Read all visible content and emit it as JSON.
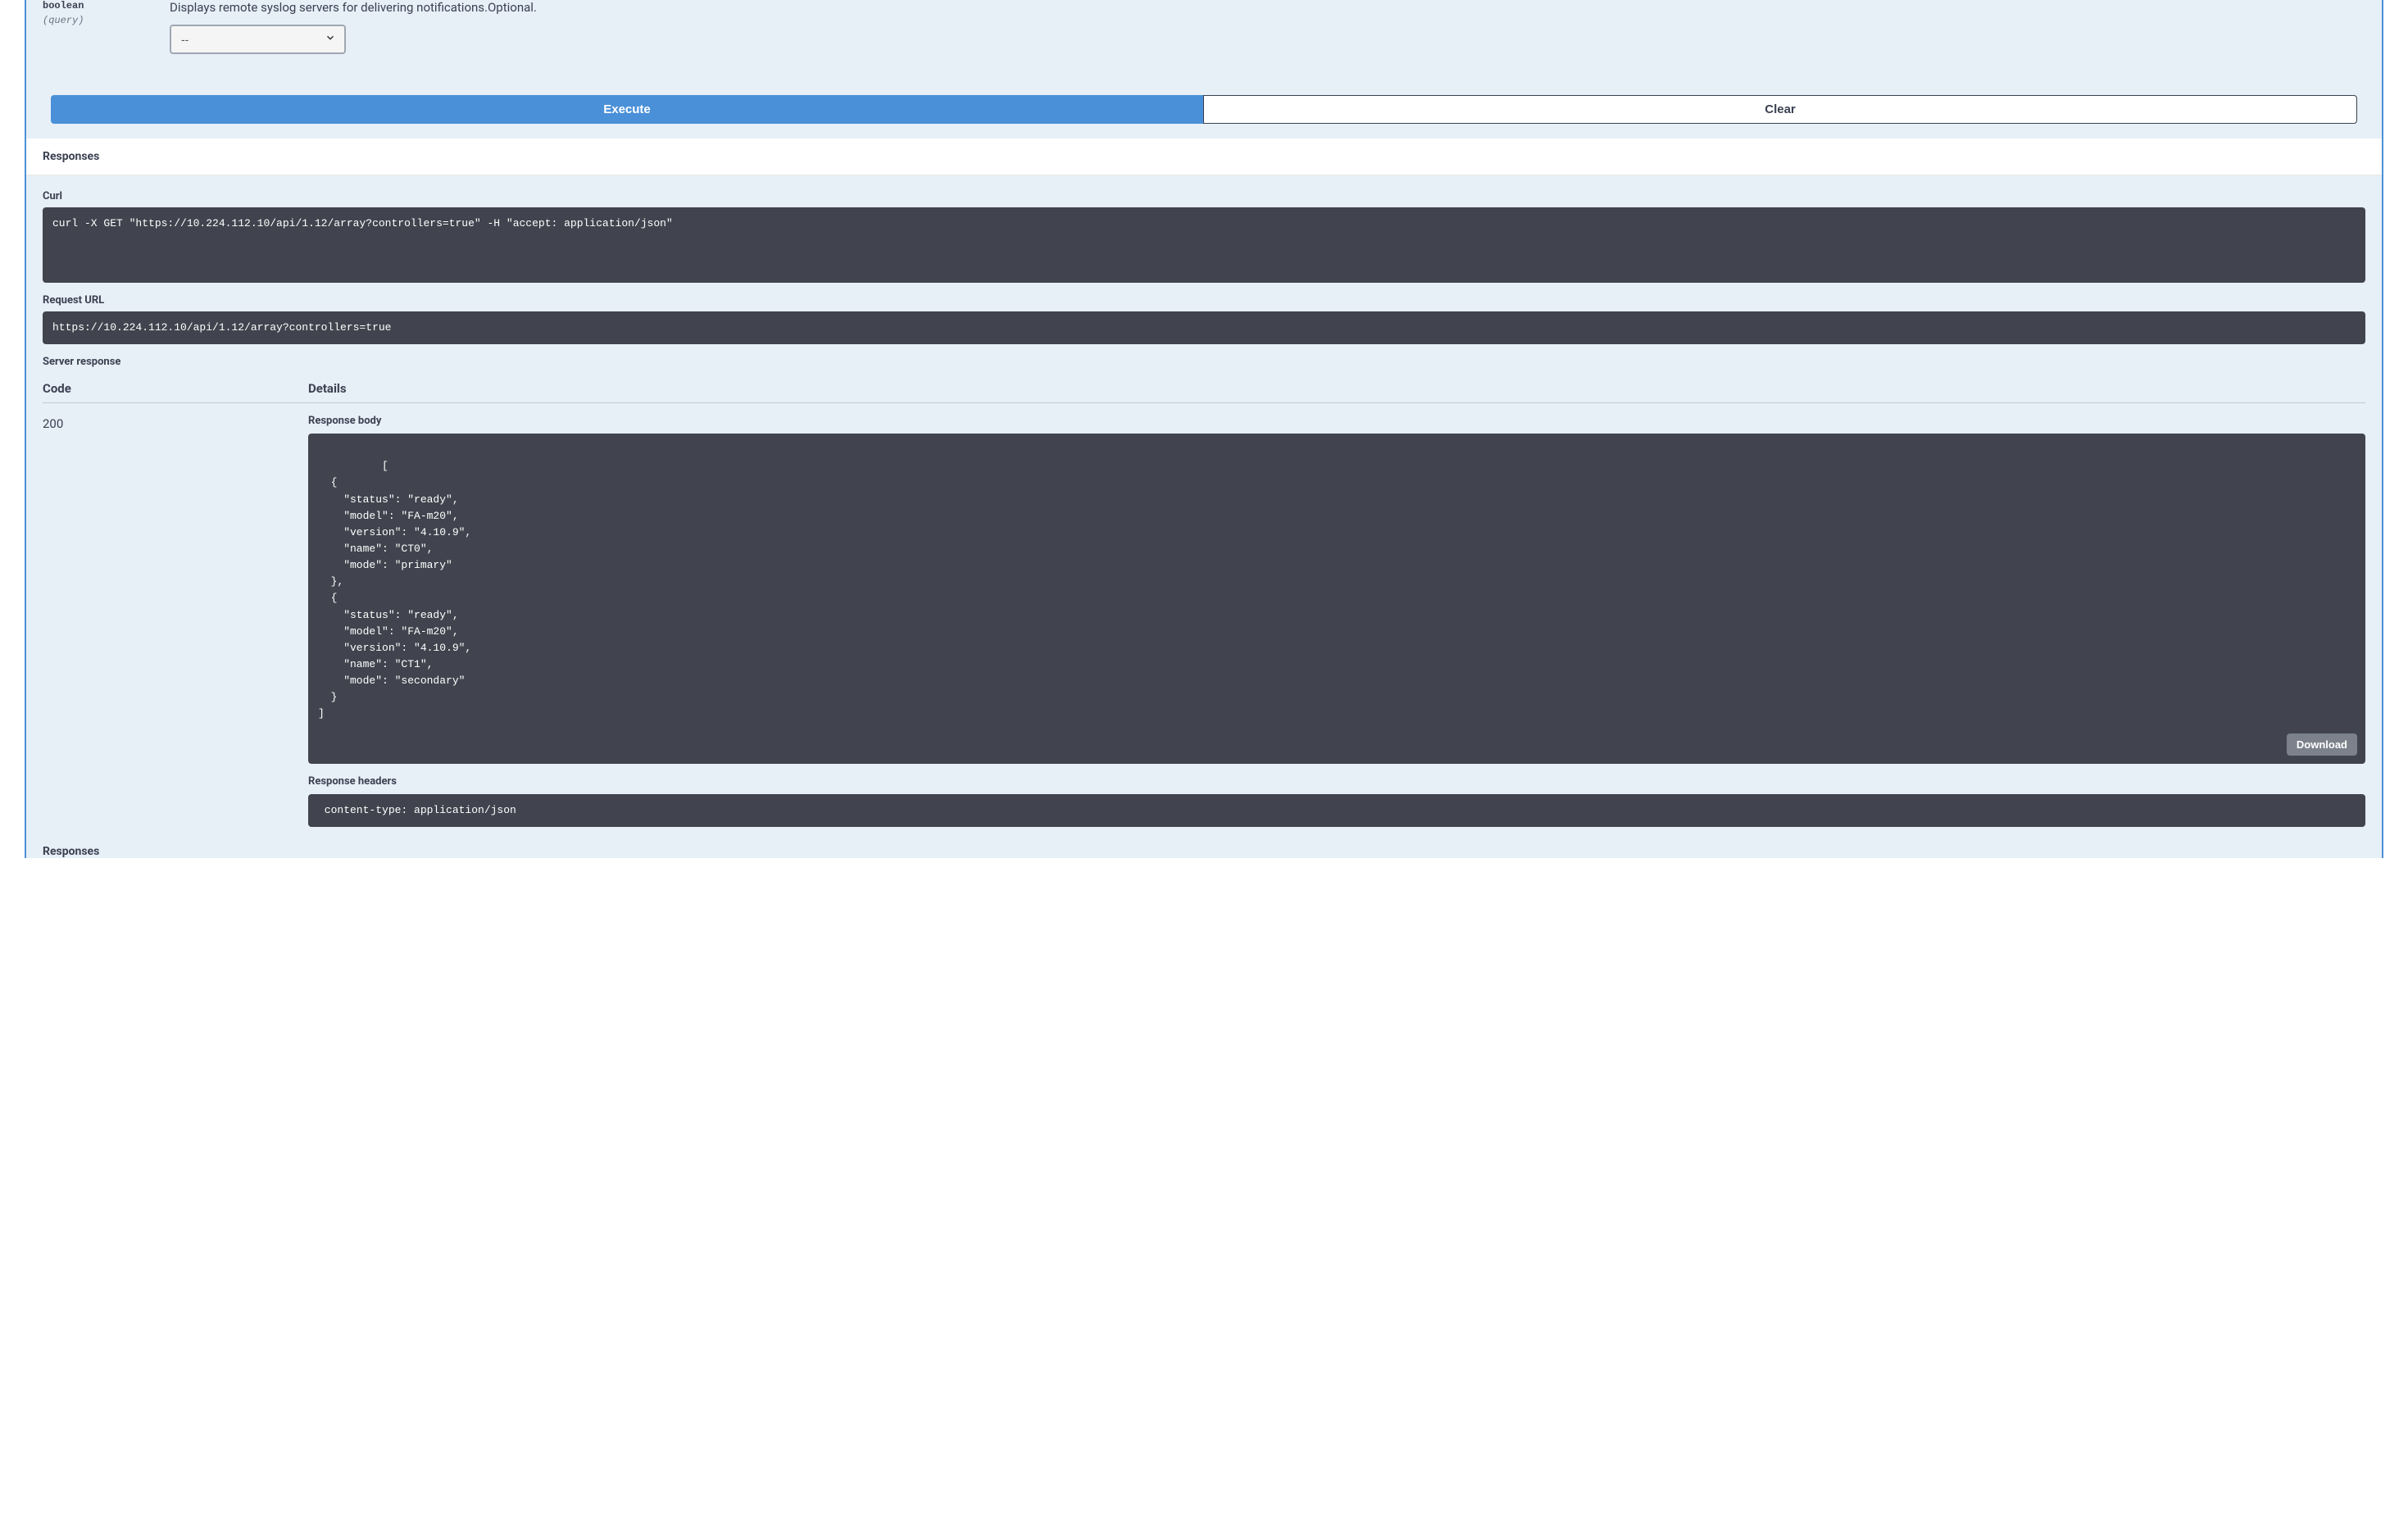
{
  "param": {
    "type": "boolean",
    "in": "(query)",
    "description": "Displays remote syslog servers for delivering notifications.Optional.",
    "select_value": "--"
  },
  "buttons": {
    "execute": "Execute",
    "clear": "Clear",
    "download": "Download"
  },
  "headings": {
    "responses": "Responses",
    "curl": "Curl",
    "request_url": "Request URL",
    "server_response": "Server response",
    "code": "Code",
    "details": "Details",
    "response_body": "Response body",
    "response_headers": "Response headers",
    "bottom_responses": "Responses"
  },
  "curl_cmd": "curl -X GET \"https://10.224.112.10/api/1.12/array?controllers=true\" -H \"accept: application/json\"",
  "request_url": "https://10.224.112.10/api/1.12/array?controllers=true",
  "response_code": "200",
  "response_body": "[\n  {\n    \"status\": \"ready\",\n    \"model\": \"FA-m20\",\n    \"version\": \"4.10.9\",\n    \"name\": \"CT0\",\n    \"mode\": \"primary\"\n  },\n  {\n    \"status\": \"ready\",\n    \"model\": \"FA-m20\",\n    \"version\": \"4.10.9\",\n    \"name\": \"CT1\",\n    \"mode\": \"secondary\"\n  }\n]",
  "response_headers": " content-type: application/json "
}
